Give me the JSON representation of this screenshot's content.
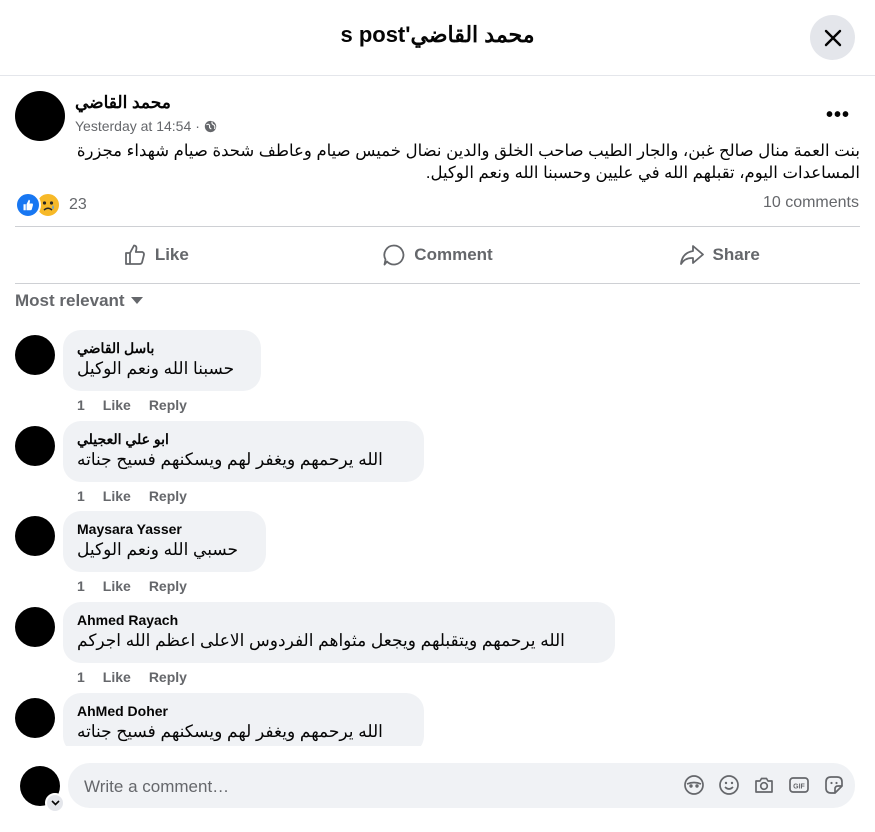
{
  "header": {
    "title": "s post'محمد القاضي"
  },
  "post": {
    "author": "محمد القاضي",
    "timestamp": "Yesterday at 14:54",
    "meta_separator": "·",
    "text": "بنت العمة منال صالح غبن، والجار الطيب صاحب الخلق والدين نضال خميس صيام وعاطف شحدة صيام شهداء مجزرة المساعدات اليوم، تقبلهم الله في عليين وحسبنا الله ونعم الوكيل.",
    "reactions_count": "23",
    "comments_count": "10 comments"
  },
  "actions": {
    "like": "Like",
    "comment": "Comment",
    "share": "Share"
  },
  "sort_label": "Most relevant",
  "comments": [
    {
      "name": "باسل القاضي",
      "text": "حسبنا الله ونعم الوكيل",
      "time": "1",
      "like": "Like",
      "reply": "Reply"
    },
    {
      "name": "ابو علي العجيلي",
      "text": "الله يرحمهم ويغفر لهم ويسكنهم فسيح جناته",
      "time": "1",
      "like": "Like",
      "reply": "Reply"
    },
    {
      "name": "Maysara Yasser",
      "text": "حسبي الله ونعم الوكيل",
      "time": "1",
      "like": "Like",
      "reply": "Reply"
    },
    {
      "name": "Ahmed Rayach",
      "text": "الله يرحمهم ويتقبلهم ويجعل مثواهم الفردوس الاعلى اعظم الله اجركم",
      "time": "1",
      "like": "Like",
      "reply": "Reply"
    },
    {
      "name": "AhMed Doher",
      "text": "الله يرحمهم ويغفر لهم ويسكنهم فسيح جناته",
      "time": "",
      "like": "",
      "reply": ""
    }
  ],
  "composer": {
    "placeholder": "Write a comment…",
    "gif_label": "GIF"
  },
  "colors": {
    "accent": "#1877f2",
    "muted": "#65676b",
    "bubble": "#f0f2f5"
  }
}
